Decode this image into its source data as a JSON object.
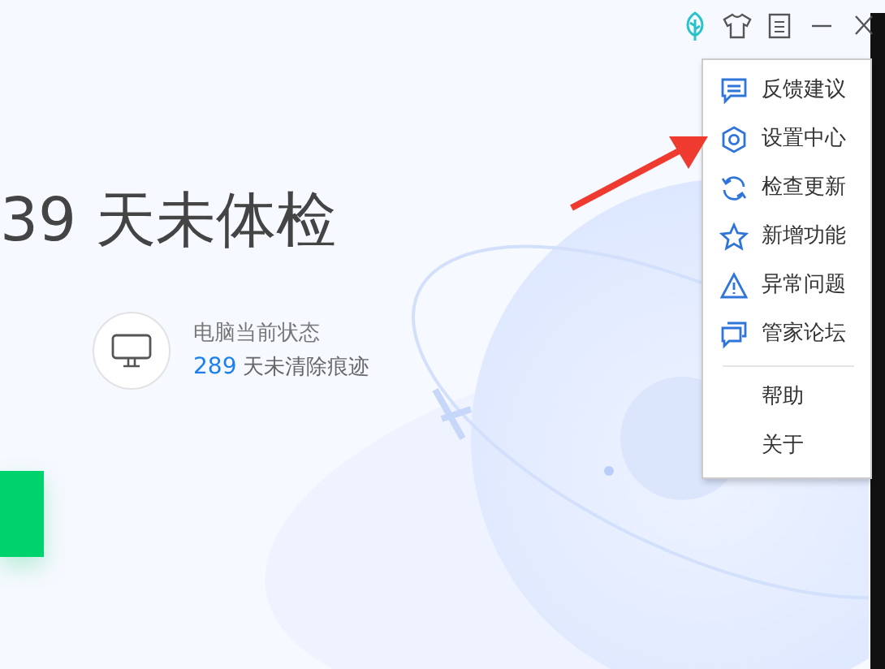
{
  "hero": {
    "title": "39 天未体检"
  },
  "status": {
    "label": "电脑当前状态",
    "count": "289",
    "text": "天未清除痕迹"
  },
  "menu": {
    "groups": [
      [
        {
          "label": "反馈建议",
          "kind": "icon"
        },
        {
          "label": "设置中心",
          "kind": "icon"
        },
        {
          "label": "检查更新",
          "kind": "icon"
        },
        {
          "label": "新增功能",
          "kind": "icon"
        },
        {
          "label": "异常问题",
          "kind": "icon"
        },
        {
          "label": "管家论坛",
          "kind": "icon"
        }
      ],
      [
        {
          "label": "帮助",
          "kind": "plain"
        },
        {
          "label": "关于",
          "kind": "plain"
        }
      ]
    ]
  }
}
